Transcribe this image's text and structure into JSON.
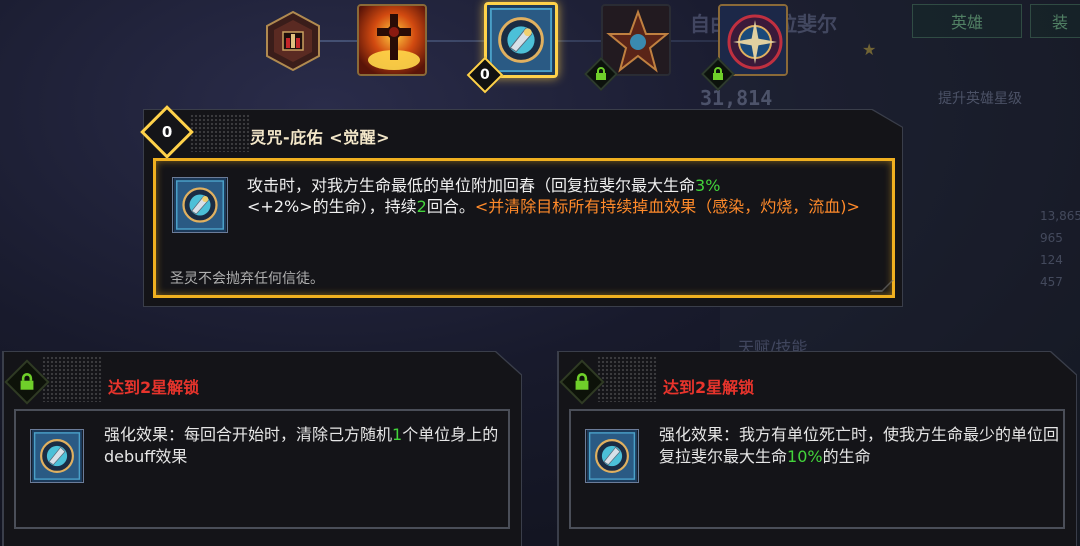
{
  "background": {
    "hero_name": "自由之盾 拉斐尔",
    "tab_hero": "英雄",
    "tab_other": "装",
    "power": "31,814",
    "upgrade": "提升英雄星级",
    "stats": [
      "13,865",
      "965",
      "124",
      "457"
    ],
    "talent_label": "天赋/技能"
  },
  "skill_strip": {
    "active_level": "0",
    "icons": [
      {
        "name": "skill-1",
        "locked": false
      },
      {
        "name": "skill-2",
        "locked": false
      },
      {
        "name": "skill-3",
        "locked": false,
        "active": true
      },
      {
        "name": "skill-4",
        "locked": true
      },
      {
        "name": "skill-5",
        "locked": true
      }
    ]
  },
  "tooltip": {
    "level": "0",
    "title": "灵咒-庇佑  <觉醒>",
    "desc_part1": "攻击时，对我方生命最低的单位附加回春（回复拉斐尔最大生命",
    "desc_pct": "3%",
    "desc_part2": "<+2%>",
    "desc_part3": "的生命），持续",
    "desc_turns": "2",
    "desc_part4": "回合。",
    "desc_extra": "<并清除目标所有持续掉血效果（感染，灼烧，流血)>",
    "flavor": "圣灵不会抛弃任何信徒。"
  },
  "upgrades": [
    {
      "unlock_label": "达到2星解锁",
      "desc_part1": "强化效果：每回合开始时，清除己方随机",
      "desc_num": "1",
      "desc_part2": "个单位身上的debuff效果"
    },
    {
      "unlock_label": "达到2星解锁",
      "desc_part1": "强化效果：我方有单位死亡时，使我方生命最少的单位回复拉斐尔最大生命",
      "desc_num": "10%",
      "desc_part2": "的生命"
    }
  ],
  "colors": {
    "gold": "#ffd24a",
    "green": "#43d43b",
    "orange": "#ff8a2a",
    "red": "#e8342c"
  }
}
